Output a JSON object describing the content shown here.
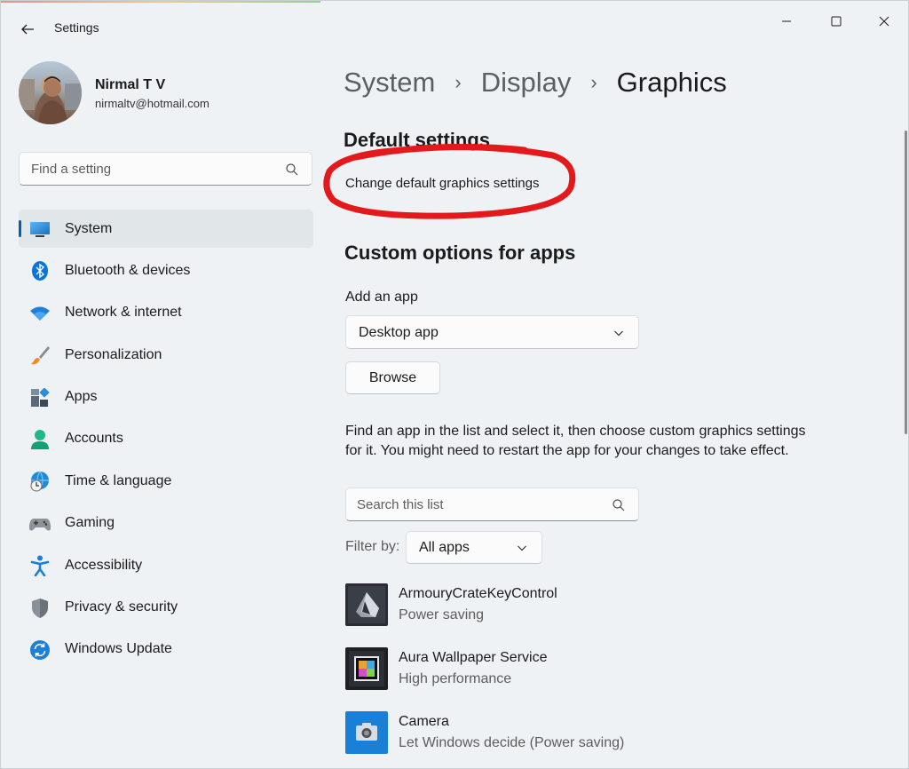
{
  "window": {
    "title": "Settings"
  },
  "profile": {
    "name": "Nirmal T V",
    "email": "nirmaltv@hotmail.com"
  },
  "search": {
    "placeholder": "Find a setting"
  },
  "sidebar": {
    "items": [
      {
        "label": "System",
        "icon": "monitor-icon",
        "active": true
      },
      {
        "label": "Bluetooth & devices",
        "icon": "bluetooth-icon"
      },
      {
        "label": "Network & internet",
        "icon": "wifi-icon"
      },
      {
        "label": "Personalization",
        "icon": "brush-icon"
      },
      {
        "label": "Apps",
        "icon": "apps-icon"
      },
      {
        "label": "Accounts",
        "icon": "person-icon"
      },
      {
        "label": "Time & language",
        "icon": "globe-clock-icon"
      },
      {
        "label": "Gaming",
        "icon": "gamepad-icon"
      },
      {
        "label": "Accessibility",
        "icon": "accessibility-icon"
      },
      {
        "label": "Privacy & security",
        "icon": "shield-icon"
      },
      {
        "label": "Windows Update",
        "icon": "update-icon"
      }
    ]
  },
  "breadcrumb": {
    "items": [
      "System",
      "Display",
      "Graphics"
    ]
  },
  "main": {
    "default_section_title": "Default settings",
    "change_link": "Change default graphics settings",
    "custom_section_title": "Custom options for apps",
    "add_app_label": "Add an app",
    "app_type_value": "Desktop app",
    "browse_label": "Browse",
    "help_text": "Find an app in the list and select it, then choose custom graphics settings for it. You might need to restart the app for your changes to take effect.",
    "list_search_placeholder": "Search this list",
    "filter_label": "Filter by:",
    "filter_value": "All apps",
    "apps": [
      {
        "name": "ArmouryCrateKeyControl",
        "setting": "Power saving"
      },
      {
        "name": "Aura Wallpaper Service",
        "setting": "High performance"
      },
      {
        "name": "Camera",
        "setting": "Let Windows decide (Power saving)"
      }
    ]
  },
  "colors": {
    "accent": "#005fb8",
    "annotation": "#e3191c",
    "background": "#eef2f4"
  }
}
